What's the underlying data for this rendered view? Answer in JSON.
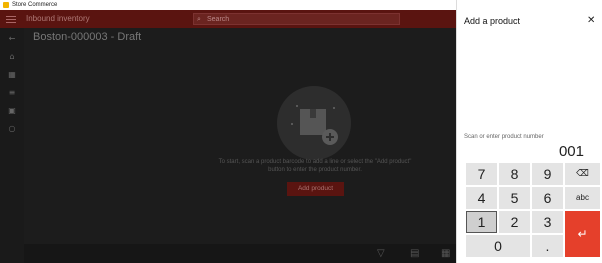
{
  "window": {
    "title": "Store Commerce",
    "controls": {
      "minimize": "–",
      "maximize": "▢",
      "close": "✕"
    }
  },
  "app": {
    "header": {
      "name": "Inbound inventory",
      "search_placeholder": "Search"
    },
    "page_title": "Boston-000003 - Draft",
    "empty_state": {
      "message": "To start, scan a product barcode to add a line or select the \"Add product\" button to enter the product number.",
      "add_button": "Add product"
    }
  },
  "panel": {
    "title": "Add a product",
    "close_glyph": "✕",
    "input_label": "Scan or enter product number",
    "input_value": "001",
    "keys": {
      "k7": "7",
      "k8": "8",
      "k9": "9",
      "backspace": "⌫",
      "k4": "4",
      "k5": "5",
      "k6": "6",
      "abc": "abc",
      "k1": "1",
      "k2": "2",
      "k3": "3",
      "enter": "↵",
      "k0": "0",
      "dot": "."
    }
  },
  "colors": {
    "header_bg": "#5a1410",
    "accent": "#e5402b",
    "key_bg": "#e4e4e4",
    "overlay": "#1c1c1c"
  }
}
